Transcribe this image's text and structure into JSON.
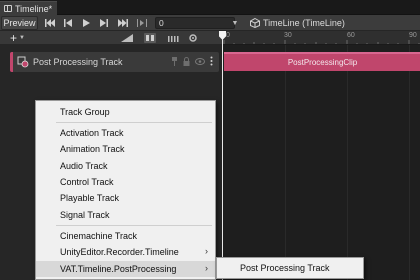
{
  "window": {
    "tab_title": "Timeline*"
  },
  "toolbar": {
    "preview_label": "Preview",
    "frame_value": "0",
    "asset_label": "TimeLine (TimeLine)"
  },
  "ruler": {
    "ticks": [
      "0",
      "30",
      "60",
      "90"
    ]
  },
  "track": {
    "name": "Post Processing Track",
    "accent_color": "#c0466c",
    "clip_label": "PostProcessingClip"
  },
  "context_menu": {
    "items": [
      {
        "label": "Track Group",
        "has_submenu": false
      },
      {
        "label": "Activation Track",
        "has_submenu": false
      },
      {
        "label": "Animation Track",
        "has_submenu": false
      },
      {
        "label": "Audio Track",
        "has_submenu": false
      },
      {
        "label": "Control Track",
        "has_submenu": false
      },
      {
        "label": "Playable Track",
        "has_submenu": false
      },
      {
        "label": "Signal Track",
        "has_submenu": false
      },
      {
        "label": "Cinemachine Track",
        "has_submenu": false
      },
      {
        "label": "UnityEditor.Recorder.Timeline",
        "has_submenu": true
      },
      {
        "label": "VAT.Timeline.PostProcessing",
        "has_submenu": true
      }
    ],
    "submenu_item": "Post Processing Track"
  }
}
